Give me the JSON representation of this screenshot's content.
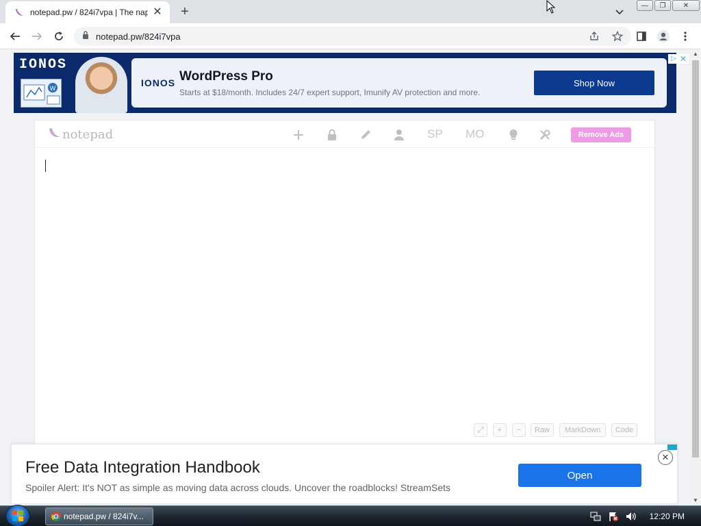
{
  "browser": {
    "tab_title": "notepad.pw / 824i7vpa | The nap",
    "new_tab_label": "+",
    "url": "notepad.pw/824i7vpa",
    "window_buttons": {
      "minimize": "—",
      "restore": "❐",
      "close": "✕"
    }
  },
  "ad_top": {
    "brand_logo": "IONOS",
    "card_logo": "IONOS",
    "title": "WordPress Pro",
    "subtitle": "Starts at $18/month. Includes 24/7 expert support, Imunify AV protection and more.",
    "cta": "Shop Now"
  },
  "notepad": {
    "logo_text": "notepad",
    "toolbar": {
      "sp_label": "SP",
      "mo_label": "MO",
      "remove_ads": "Remove Ads"
    },
    "content": "",
    "bottom_buttons": {
      "raw": "Raw",
      "markdown": "MarkDown",
      "code": "Code"
    }
  },
  "ad_bottom": {
    "title": "Free Data Integration Handbook",
    "subtitle": "Spoiler Alert: It's NOT as simple as moving data across clouds. Uncover the roadblocks! StreamSets",
    "cta": "Open"
  },
  "taskbar": {
    "window_label": "notepad.pw / 824i7v...",
    "clock": "12:20 PM"
  },
  "colors": {
    "ionos_navy": "#0b2a6b",
    "notepad_pink": "#ec9be4",
    "open_blue": "#1a73e8"
  }
}
